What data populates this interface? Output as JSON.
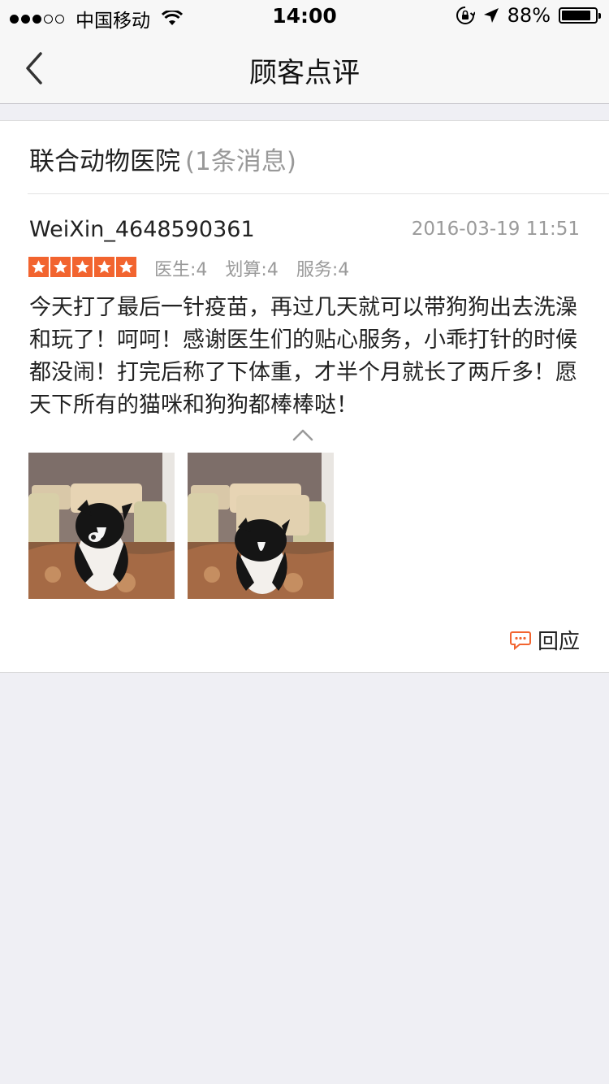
{
  "status": {
    "carrier": "中国移动",
    "time": "14:00",
    "battery": "88%",
    "battery_level": 0.88,
    "signal_filled": 3,
    "signal_total": 5
  },
  "nav": {
    "title": "顾客点评"
  },
  "shop": {
    "name": "联合动物医院",
    "count": "(1条消息)"
  },
  "review": {
    "username": "WeiXin_4648590361",
    "date": "2016-03-19 11:51",
    "rating": 5,
    "scores": [
      "医生:4",
      "划算:4",
      "服务:4"
    ],
    "text": "今天打了最后一针疫苗，再过几天就可以带狗狗出去洗澡和玩了！呵呵！感谢医生们的贴心服务，小乖打针的时候都没闹！打完后称了下体重，才半个月就长了两斤多！愿天下所有的猫咪和狗狗都棒棒哒！",
    "photo_count": 2,
    "reply_label": "回应"
  },
  "colors": {
    "accent": "#f2642f",
    "muted": "#9a9a9a",
    "background": "#efeff4"
  }
}
